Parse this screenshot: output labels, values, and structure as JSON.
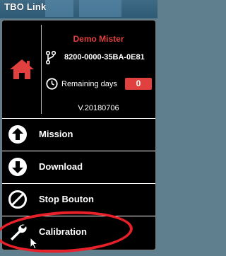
{
  "window": {
    "title": "TBO Link"
  },
  "device": {
    "name": "Demo Mister",
    "serial": "8200-0000-35BA-0E81",
    "remaining_days_label": "Remaining days",
    "remaining_days_value": "0",
    "version": "V.20180706"
  },
  "menu": {
    "items": [
      {
        "label": "Mission",
        "icon": "arrow-up-circle-icon"
      },
      {
        "label": "Download",
        "icon": "arrow-down-circle-icon"
      },
      {
        "label": "Stop Bouton",
        "icon": "no-entry-circle-icon"
      },
      {
        "label": "Calibration",
        "icon": "wrench-icon"
      }
    ]
  },
  "colors": {
    "accent_red": "#e0413f",
    "panel_bg": "#000000",
    "text": "#ffffff",
    "annotation_circle": "#e8202a"
  }
}
